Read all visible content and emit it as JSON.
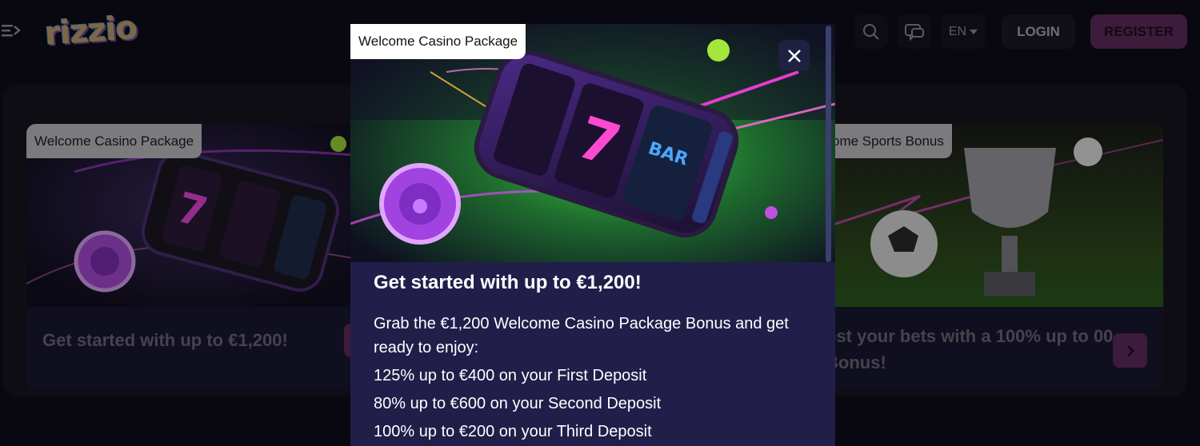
{
  "header": {
    "logo_text": "rizzio",
    "language": "EN",
    "login_label": "LOGIN",
    "register_label": "REGISTER"
  },
  "promos": {
    "casino": {
      "badge": "Welcome Casino Package",
      "text": "Get started with up to €1,200!"
    },
    "sports": {
      "badge": "ome Sports Bonus",
      "text": "ost your bets with a 100% up to 00 Bonus!"
    }
  },
  "modal": {
    "badge": "Welcome Casino Package",
    "title": "Get started with up to €1,200!",
    "intro": "Grab the €1,200 Welcome Casino Package Bonus and get ready to enjoy:",
    "lines": [
      "125% up to €400 on your First Deposit",
      "80% up to €600 on your Second Deposit",
      "100% up to €200 on your Third Deposit"
    ]
  },
  "colors": {
    "background": "#0e0c19",
    "accent": "#5e2a5c",
    "modal_bg": "#211e4a"
  },
  "icons": [
    "menu-icon",
    "search-icon",
    "chat-icon",
    "caret-down-icon",
    "close-icon",
    "chevron-right-icon"
  ]
}
